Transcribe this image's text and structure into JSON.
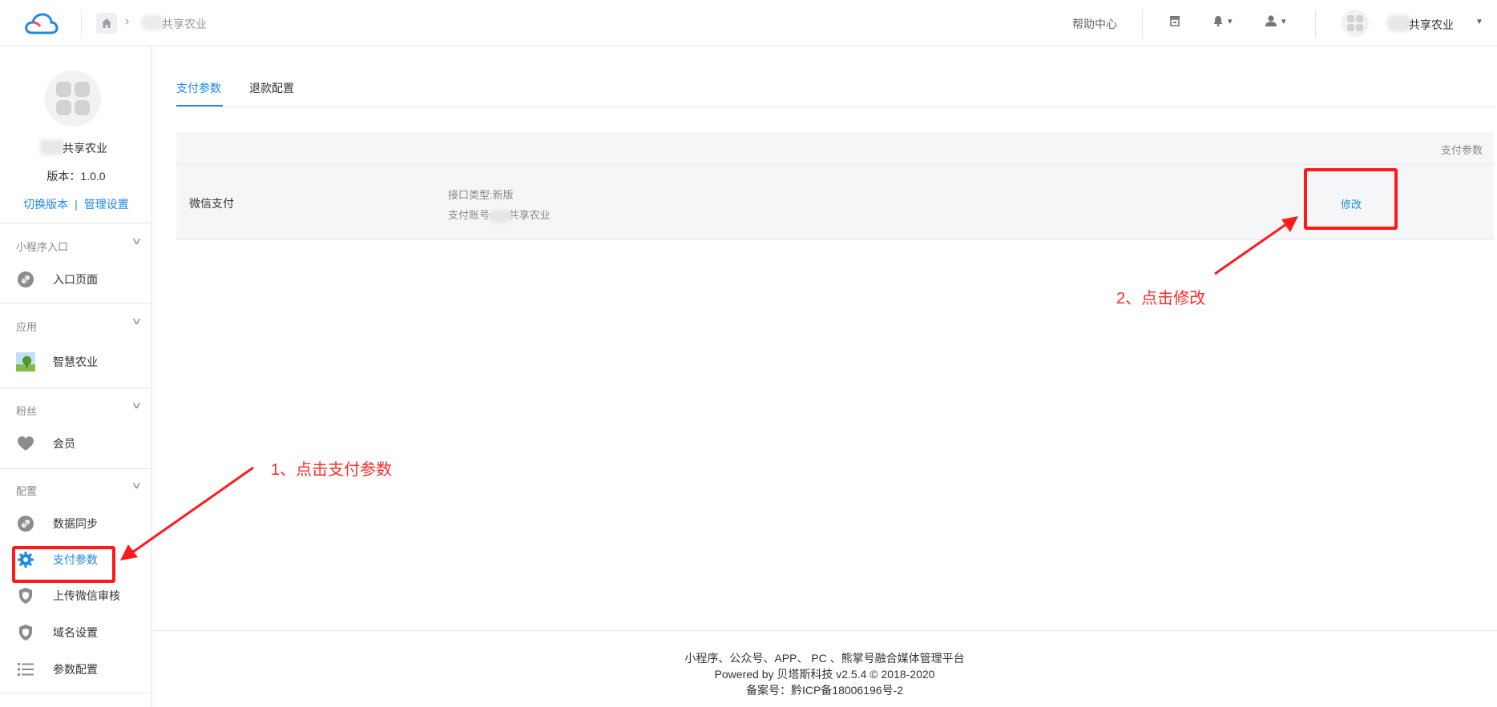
{
  "topbar": {
    "breadcrumb_text": "共享农业",
    "help_label": "帮助中心",
    "account_name": "共享农业"
  },
  "sidebar": {
    "app_name": "共享农业",
    "version": "版本：1.0.0",
    "switch_version": "切换版本",
    "link_separator": "|",
    "manage_settings": "管理设置",
    "groups": [
      {
        "title": "小程序入口",
        "items": [
          {
            "label": "入口页面",
            "icon": "link-icon"
          }
        ]
      },
      {
        "title": "应用",
        "items": [
          {
            "label": "智慧农业",
            "icon": "app-thumbnail-icon"
          }
        ]
      },
      {
        "title": "粉丝",
        "items": [
          {
            "label": "会员",
            "icon": "heart-icon"
          }
        ]
      },
      {
        "title": "配置",
        "items": [
          {
            "label": "数据同步",
            "icon": "link-icon"
          },
          {
            "label": "支付参数",
            "icon": "gear-icon",
            "active": true
          },
          {
            "label": "上传微信审核",
            "icon": "shield-icon"
          },
          {
            "label": "域名设置",
            "icon": "shield-icon"
          },
          {
            "label": "参数配置",
            "icon": "list-icon"
          }
        ]
      }
    ]
  },
  "main": {
    "tabs": [
      {
        "label": "支付参数",
        "active": true
      },
      {
        "label": "退款配置",
        "active": false
      }
    ],
    "table": {
      "header": "支付参数",
      "rows": [
        {
          "name": "微信支付",
          "info_type": "接口类型:新版",
          "info_account_prefix": "支付账号:",
          "info_account_name": "共享农业",
          "action": "修改"
        }
      ]
    }
  },
  "footer": {
    "line1": "小程序、公众号、APP、 PC 、熊掌号融合媒体管理平台",
    "line2": "Powered by 贝塔斯科技 v2.5.4 © 2018-2020",
    "line3": "备案号：黔ICP备18006196号-2"
  },
  "annotations": {
    "step1": "1、点击支付参数",
    "step2": "2、点击修改"
  },
  "colors": {
    "accent": "#1e88e5",
    "annotation_red": "#ff1a1a"
  }
}
